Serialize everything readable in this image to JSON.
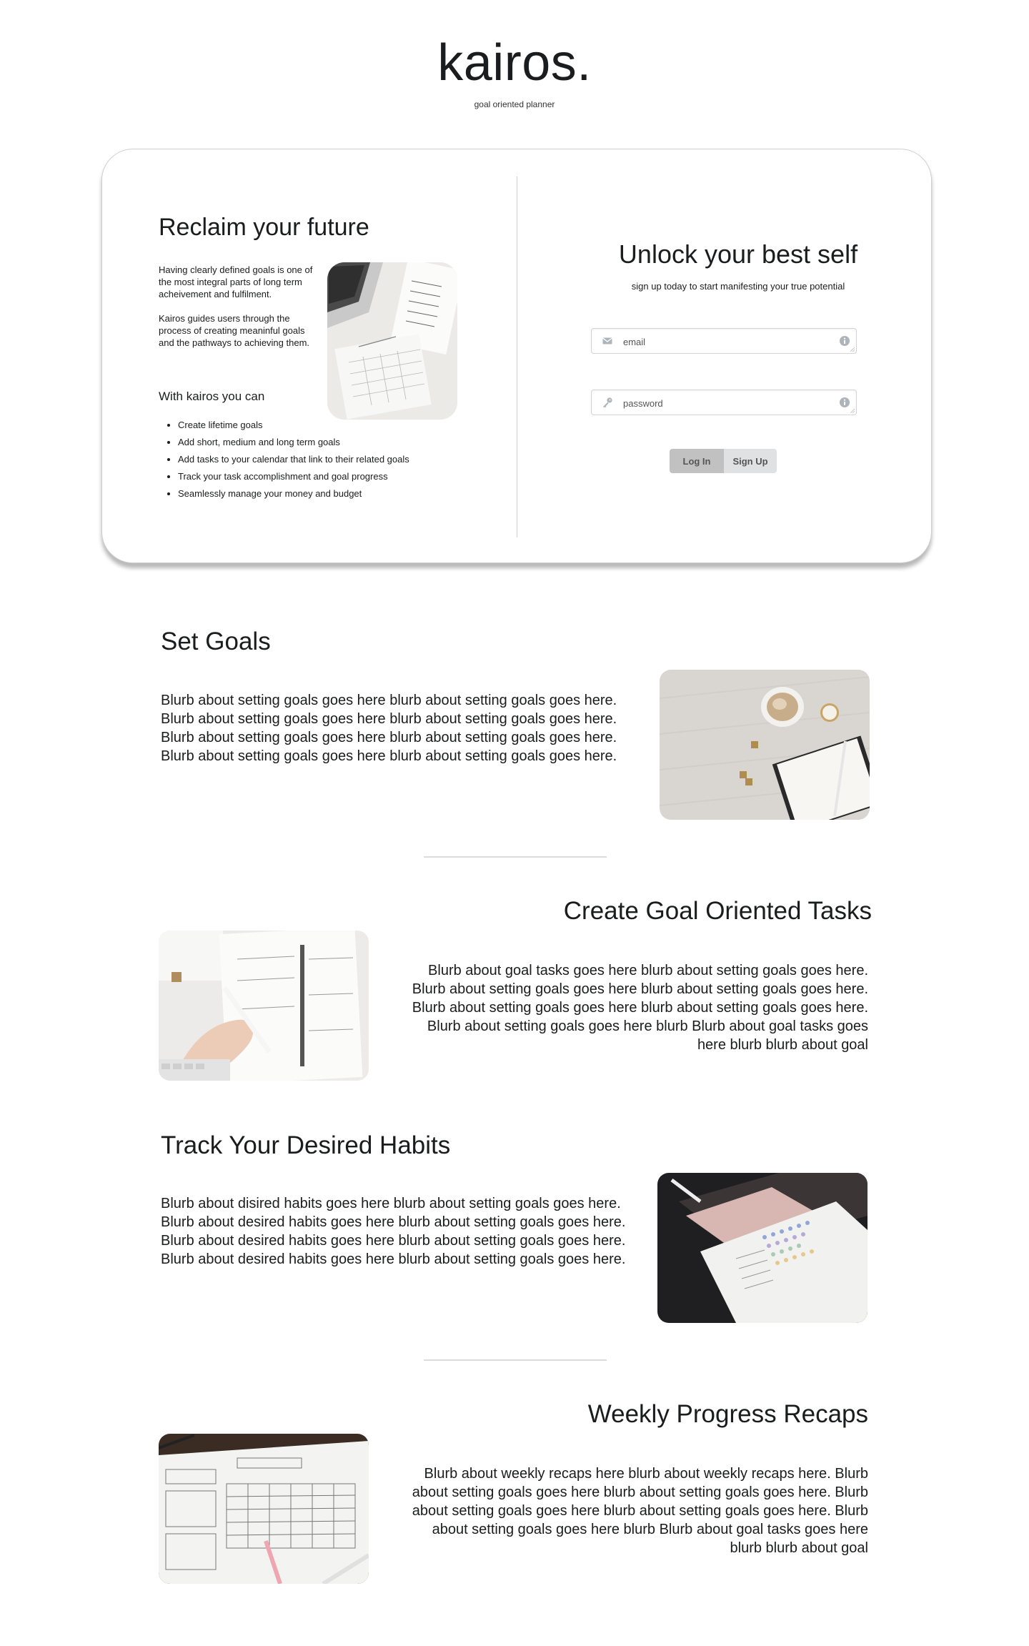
{
  "brand": {
    "name": "kairos.",
    "tagline": "goal oriented planner"
  },
  "intro": {
    "title": "Reclaim your future",
    "paragraphs": [
      "Having clearly defined goals is one of the most integral parts of long term acheivement and fulfilment.",
      "Kairos guides users through the process of creating meaninful goals and the pathways to achieving them."
    ],
    "list_heading": "With kairos you can",
    "features": [
      "Create lifetime goals",
      "Add short, medium and long term goals",
      "Add tasks to your calendar that link to their related goals",
      "Track your task accomplishment and goal progress",
      "Seamlessly manage your money and budget"
    ]
  },
  "signup": {
    "title": "Unlock your best self",
    "subtitle": "sign up today to start manifesting your true potential",
    "email_placeholder": "email",
    "password_placeholder": "password",
    "login_label": "Log In",
    "signup_label": "Sign Up",
    "email_icon": "envelope-icon",
    "password_icon": "key-icon",
    "info_icon": "info-circle-icon"
  },
  "sections": [
    {
      "title": "Set Goals",
      "body": "Blurb about setting goals goes here blurb about setting goals goes here. Blurb about setting goals goes here blurb about setting goals goes here. Blurb about setting goals goes here blurb about setting goals goes here. Blurb about setting goals goes here blurb about setting goals goes here."
    },
    {
      "title": "Create Goal Oriented Tasks",
      "body": "Blurb about goal tasks goes here blurb about setting goals goes here. Blurb about setting goals goes here blurb about setting goals goes here. Blurb about setting goals goes here blurb about setting goals goes here. Blurb about setting goals goes here blurb Blurb about goal tasks goes here blurb blurb about goal"
    },
    {
      "title": "Track Your Desired Habits",
      "body": "Blurb about disired habits goes here blurb about setting goals goes here. Blurb about desired habits goes here blurb about setting goals goes here. Blurb about desired habits goes here blurb about setting goals goes here. Blurb about desired habits goes here blurb about setting goals goes here."
    },
    {
      "title": "Weekly Progress Recaps",
      "body": "Blurb about weekly recaps here blurb about weekly recaps here. Blurb about setting goals goes here blurb about setting goals goes here. Blurb about setting goals goes here blurb about setting goals goes here. Blurb about setting goals goes here blurb Blurb about goal tasks goes here blurb blurb about goal"
    }
  ],
  "colors": {
    "text": "#1b1c1d",
    "card_border": "#cfcfcf",
    "login_button": "#c1c1c1",
    "signup_button": "#e0e1e2"
  }
}
